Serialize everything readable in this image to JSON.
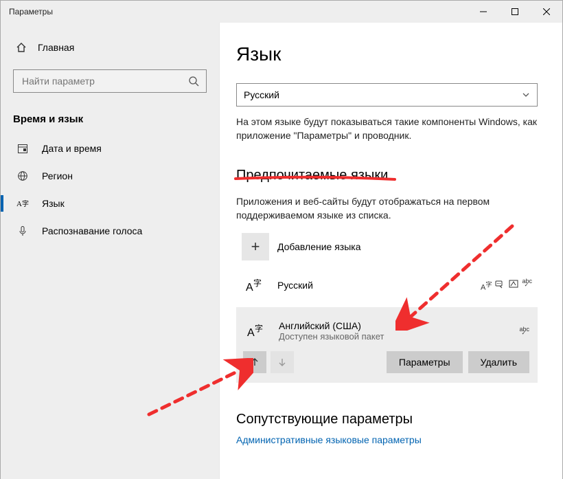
{
  "window": {
    "title": "Параметры"
  },
  "sidebar": {
    "home": "Главная",
    "search_placeholder": "Найти параметр",
    "group": "Время и язык",
    "items": [
      {
        "label": "Дата и время"
      },
      {
        "label": "Регион"
      },
      {
        "label": "Язык"
      },
      {
        "label": "Распознавание голоса"
      }
    ]
  },
  "main": {
    "title": "Язык",
    "dropdown_value": "Русский",
    "dropdown_desc": "На этом языке будут показываться такие компоненты Windows, как приложение \"Параметры\" и проводник.",
    "preferred_title": "Предпочитаемые языки",
    "preferred_desc": "Приложения и веб-сайты будут отображаться на первом поддерживаемом языке из списка.",
    "add_language": "Добавление языка",
    "lang1": {
      "name": "Русский"
    },
    "lang2": {
      "name": "Английский (США)",
      "sub": "Доступен языковой пакет"
    },
    "options_btn": "Параметры",
    "remove_btn": "Удалить",
    "related_title": "Сопутствующие параметры",
    "related_link": "Административные языковые параметры"
  }
}
